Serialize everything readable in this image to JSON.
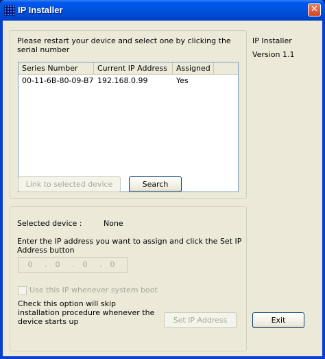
{
  "window": {
    "title": "IP Installer",
    "close_glyph": "✕"
  },
  "instructions": "Please restart your device and select one by clicking the serial number",
  "device_list": {
    "columns": [
      "Series Number",
      "Current IP Address",
      "Assigned"
    ],
    "rows": [
      {
        "serial": "00-11-6B-80-09-B7",
        "ip": "192.168.0.99",
        "assigned": "Yes"
      }
    ]
  },
  "buttons": {
    "link": "Link to selected device",
    "search": "Search",
    "set_ip": "Set IP Address",
    "exit": "Exit"
  },
  "side_info": {
    "app_name": "IP Installer",
    "version": "Version 1.1"
  },
  "selected": {
    "label": "Selected device :",
    "value": "None"
  },
  "ip_prompt": "Enter the IP address you want to assign and click the Set IP Address button",
  "ip_input": {
    "octets": [
      "0",
      "0",
      "0",
      "0"
    ],
    "separator": "."
  },
  "boot_option": {
    "checkbox_label": "Use this IP whenever system boot",
    "note": "Check this option will skip installation procedure whenever the device starts up"
  }
}
